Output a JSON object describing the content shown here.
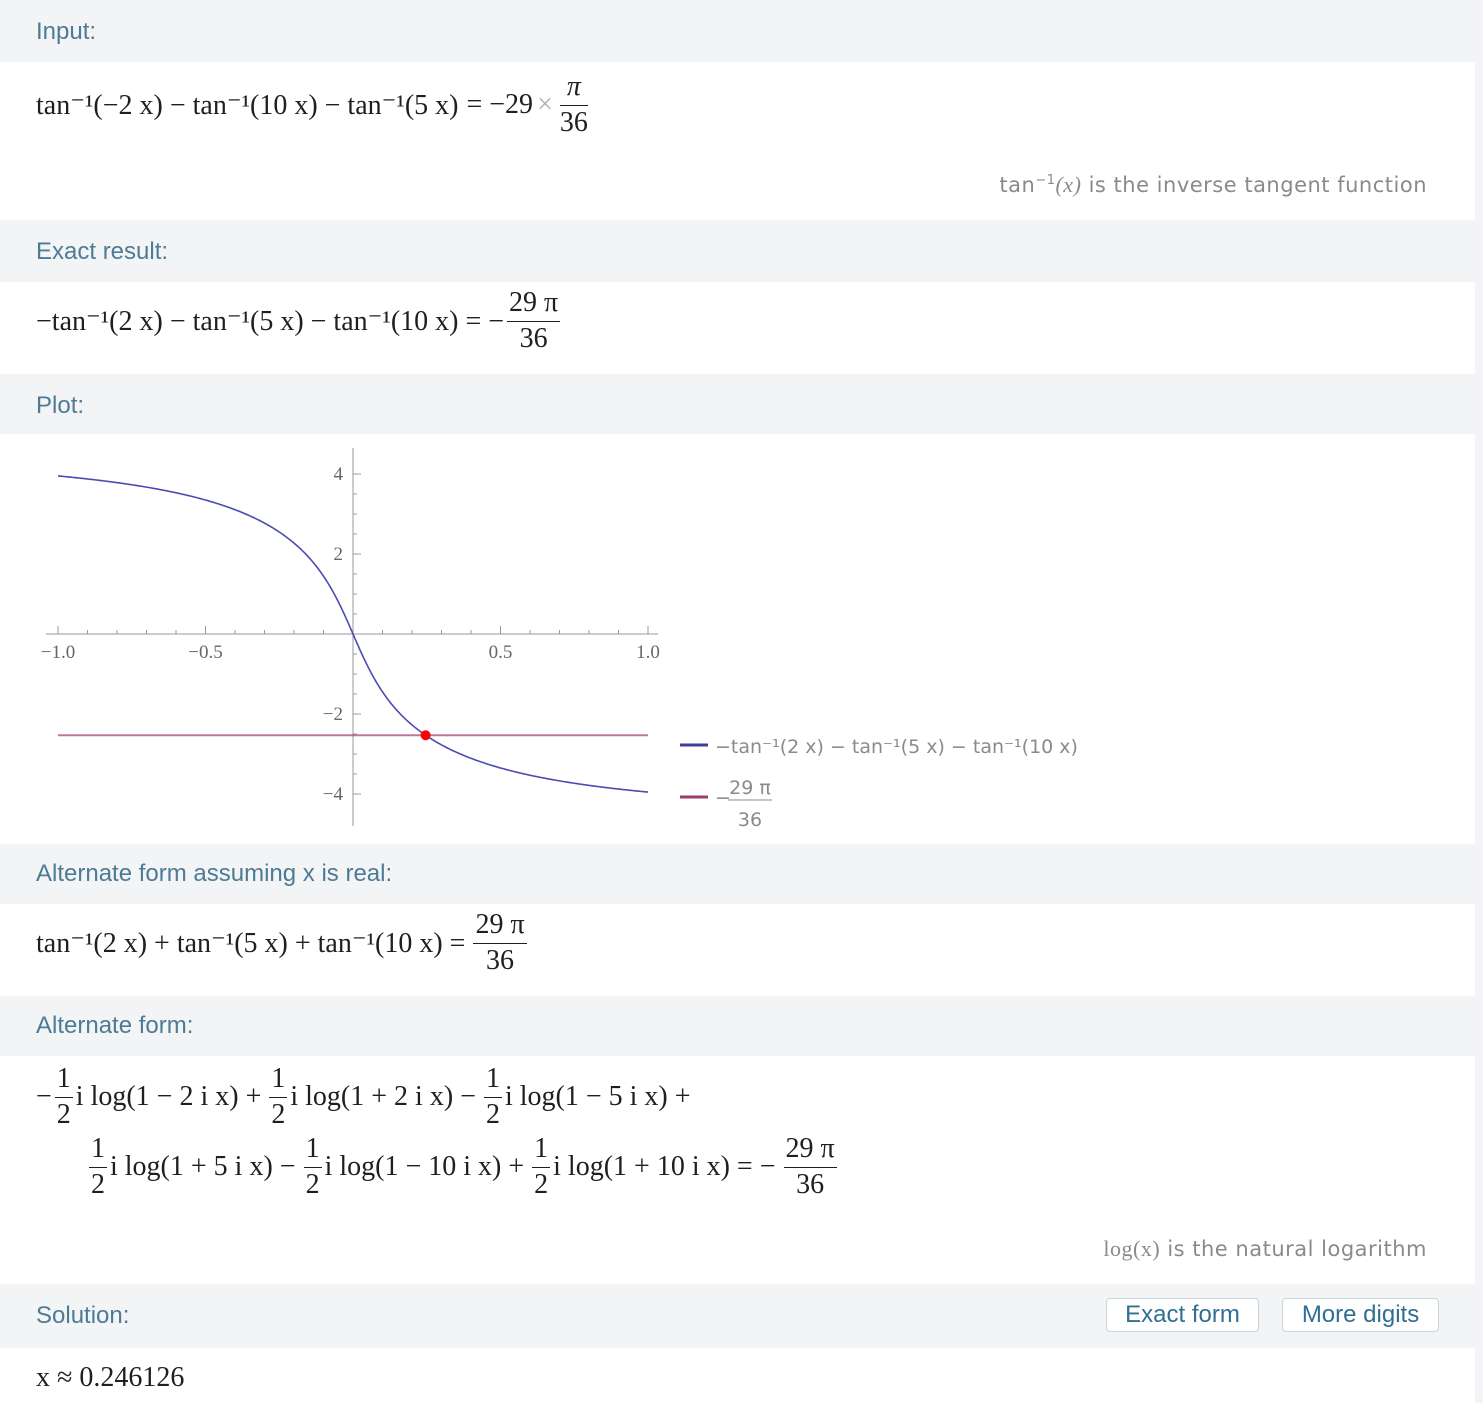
{
  "pods": {
    "input": {
      "title": "Input:",
      "lhs": "tan⁻¹(−2 x) − tan⁻¹(10 x) − tan⁻¹(5 x)",
      "rhs_prefix": "= −29",
      "times": "×",
      "rhs_num": "π",
      "rhs_den": "36",
      "note_fn": "tan",
      "note_sup": "−1",
      "note_arg": "(x)",
      "note_text": " is the inverse tangent function"
    },
    "exact": {
      "title": "Exact result:",
      "lhs": "−tan⁻¹(2 x) − tan⁻¹(5 x) − tan⁻¹(10 x) = −",
      "rhs_num": "29 π",
      "rhs_den": "36"
    },
    "plot": {
      "title": "Plot:"
    },
    "alt_real": {
      "title": "Alternate form assuming x is real:",
      "lhs": "tan⁻¹(2 x) + tan⁻¹(5 x) + tan⁻¹(10 x) =",
      "rhs_num": "29 π",
      "rhs_den": "36"
    },
    "alt": {
      "title": "Alternate form:",
      "half_num": "1",
      "half_den": "2",
      "line1": [
        {
          "sign": "−",
          "term": "i log(1 − 2 i x) +"
        },
        {
          "sign": "",
          "term": "i log(1 + 2 i x) −"
        },
        {
          "sign": "",
          "term": "i log(1 − 5 i x) +"
        }
      ],
      "line2": [
        {
          "sign": "",
          "term": "i log(1 + 5 i x) −"
        },
        {
          "sign": "",
          "term": "i log(1 − 10 i x) +"
        },
        {
          "sign": "",
          "term": "i log(1 + 10 i x) = −"
        }
      ],
      "rhs_num": "29 π",
      "rhs_den": "36",
      "note_fn": "log(x)",
      "note_text": " is the natural logarithm"
    },
    "solution": {
      "title": "Solution:",
      "exact_form_label": "Exact form",
      "more_digits_label": "More digits",
      "value": "x ≈ 0.246126"
    }
  },
  "chart_data": {
    "type": "line",
    "x_ticks": [
      "−1.0",
      "−0.5",
      "0.5",
      "1.0"
    ],
    "y_ticks": [
      "4",
      "2",
      "−2",
      "−4"
    ],
    "xlim": [
      -1.0,
      1.0
    ],
    "ylim": [
      -4.3,
      4.3
    ],
    "series": [
      {
        "name": "−tan⁻¹(2 x) − tan⁻¹(5 x) − tan⁻¹(10 x)",
        "color": "#4b4bb3",
        "function": "-atan(2x)-atan(5x)-atan(10x)"
      },
      {
        "name": "−29 π / 36",
        "color": "#a84a7c",
        "value": -2.5307
      }
    ],
    "intersection": {
      "x": 0.246126,
      "y": -2.5307,
      "color": "#ff0000"
    },
    "legend": [
      {
        "label": "−tan⁻¹(2 x) − tan⁻¹(5 x) − tan⁻¹(10 x)",
        "color": "#3d3d9e"
      },
      {
        "label_minus": "−",
        "label_num": "29 π",
        "label_den": "36",
        "color": "#9b3b6e"
      }
    ],
    "legend_position": "right"
  }
}
